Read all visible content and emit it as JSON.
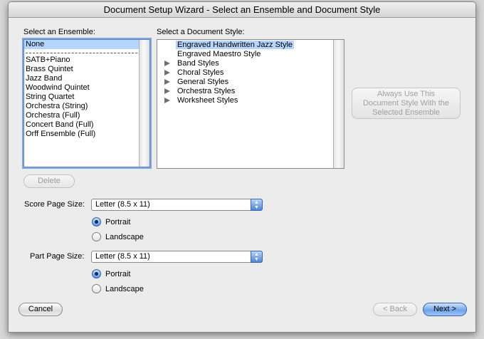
{
  "window": {
    "title": "Document Setup Wizard - Select an Ensemble and Document Style"
  },
  "ensemble": {
    "label": "Select an Ensemble:",
    "items": [
      {
        "label": "None",
        "selected": true
      },
      {
        "label": "SATB+Piano"
      },
      {
        "label": "Brass Quintet"
      },
      {
        "label": "Jazz Band"
      },
      {
        "label": "Woodwind Quintet"
      },
      {
        "label": "String Quartet"
      },
      {
        "label": "Orchestra (String)"
      },
      {
        "label": "Orchestra (Full)"
      },
      {
        "label": "Concert Band (Full)"
      },
      {
        "label": "Orff Ensemble (Full)"
      }
    ],
    "delete_label": "Delete"
  },
  "style": {
    "label": "Select a Document Style:",
    "items": [
      {
        "label": "Engraved Handwritten Jazz Style",
        "selected": true,
        "expandable": false
      },
      {
        "label": "Engraved Maestro Style",
        "expandable": false
      },
      {
        "label": "Band Styles",
        "expandable": true
      },
      {
        "label": "Choral Styles",
        "expandable": true
      },
      {
        "label": "General Styles",
        "expandable": true
      },
      {
        "label": "Orchestra Styles",
        "expandable": true
      },
      {
        "label": "Worksheet Styles",
        "expandable": true
      }
    ],
    "always_use_label": [
      "Always Use This",
      "Document Style With the",
      "Selected Ensemble"
    ]
  },
  "score_page": {
    "label": "Score Page Size:",
    "value": "Letter (8.5 x 11)",
    "portrait_label": "Portrait",
    "landscape_label": "Landscape",
    "orientation": "portrait"
  },
  "part_page": {
    "label": "Part Page Size:",
    "value": "Letter (8.5 x 11)",
    "portrait_label": "Portrait",
    "landscape_label": "Landscape",
    "orientation": "portrait"
  },
  "footer": {
    "cancel_label": "Cancel",
    "back_label": "< Back",
    "next_label": "Next >"
  }
}
